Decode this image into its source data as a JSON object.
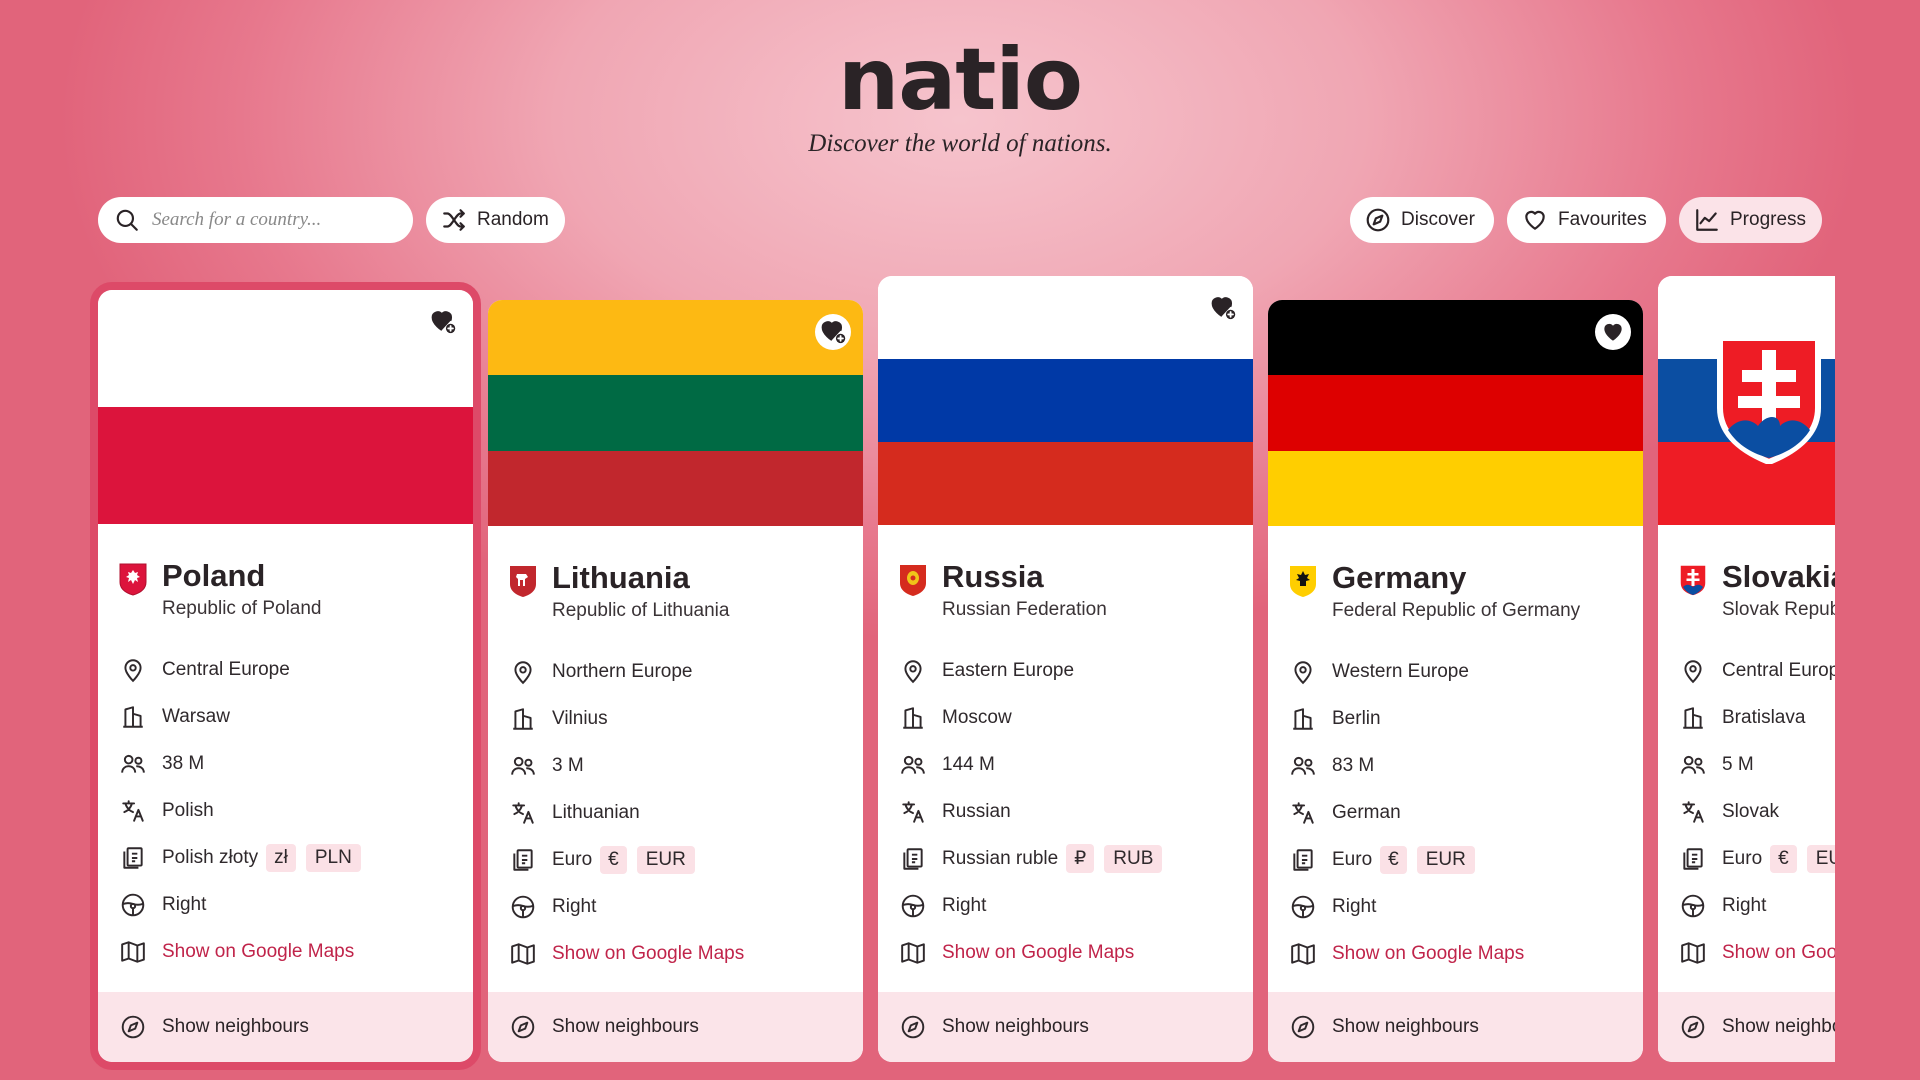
{
  "app": {
    "logo": "natio",
    "tagline": "Discover the world of nations."
  },
  "search": {
    "placeholder": "Search for a country..."
  },
  "toolbar": {
    "random_label": "Random",
    "discover_label": "Discover",
    "favourites_label": "Favourites",
    "progress_label": "Progress"
  },
  "colors": {
    "accent": "#c0244a",
    "selected_border": "#dd4a68",
    "tag_bg": "#fbe1e6"
  },
  "cards": [
    {
      "name": "Poland",
      "official": "Republic of Poland",
      "region": "Central Europe",
      "capital": "Warsaw",
      "population": "38 M",
      "language": "Polish",
      "currency": "Polish złoty",
      "currency_symbol": "zł",
      "currency_code": "PLN",
      "driving_side": "Right",
      "maps_link": "Show on Google Maps",
      "neighbours": "Show neighbours",
      "favourite": false,
      "selected": true,
      "flag_colors": [
        "#ffffff",
        "#dc143c"
      ]
    },
    {
      "name": "Lithuania",
      "official": "Republic of Lithuania",
      "region": "Northern Europe",
      "capital": "Vilnius",
      "population": "3 M",
      "language": "Lithuanian",
      "currency": "Euro",
      "currency_symbol": "€",
      "currency_code": "EUR",
      "driving_side": "Right",
      "maps_link": "Show on Google Maps",
      "neighbours": "Show neighbours",
      "favourite": false,
      "selected": false,
      "flag_colors": [
        "#fdb913",
        "#006a44",
        "#c1272d"
      ]
    },
    {
      "name": "Russia",
      "official": "Russian Federation",
      "region": "Eastern Europe",
      "capital": "Moscow",
      "population": "144 M",
      "language": "Russian",
      "currency": "Russian ruble",
      "currency_symbol": "₽",
      "currency_code": "RUB",
      "driving_side": "Right",
      "maps_link": "Show on Google Maps",
      "neighbours": "Show neighbours",
      "favourite": false,
      "selected": false,
      "flag_colors": [
        "#ffffff",
        "#0039a6",
        "#d52b1e"
      ]
    },
    {
      "name": "Germany",
      "official": "Federal Republic of Germany",
      "region": "Western Europe",
      "capital": "Berlin",
      "population": "83 M",
      "language": "German",
      "currency": "Euro",
      "currency_symbol": "€",
      "currency_code": "EUR",
      "driving_side": "Right",
      "maps_link": "Show on Google Maps",
      "neighbours": "Show neighbours",
      "favourite": true,
      "selected": false,
      "flag_colors": [
        "#000000",
        "#dd0000",
        "#ffce00"
      ]
    },
    {
      "name": "Slovakia",
      "official": "Slovak Republic",
      "region": "Central Europe",
      "capital": "Bratislava",
      "population": "5 M",
      "language": "Slovak",
      "currency": "Euro",
      "currency_symbol": "€",
      "currency_code": "EUR",
      "driving_side": "Right",
      "maps_link": "Show on Google Maps",
      "neighbours": "Show neighbours",
      "favourite": false,
      "selected": false,
      "flag_colors": [
        "#ffffff",
        "#0b4ea2",
        "#ee1c25"
      ]
    }
  ]
}
